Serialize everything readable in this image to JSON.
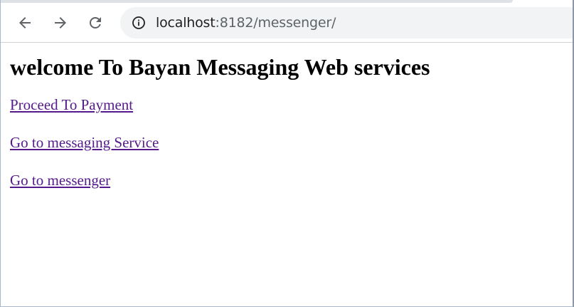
{
  "browser": {
    "url_host": "localhost",
    "url_rest": ":8182/messenger/",
    "icons": {
      "back": "back-arrow-icon",
      "forward": "forward-arrow-icon",
      "reload": "reload-icon",
      "info": "info-icon"
    }
  },
  "page": {
    "heading": "welcome To Bayan Messaging Web services",
    "links": [
      {
        "label": "Proceed To Payment"
      },
      {
        "label": "Go to messaging Service"
      },
      {
        "label": "Go to messenger"
      }
    ]
  },
  "colors": {
    "visited_link": "#551a8b",
    "omnibox_bg": "#f1f3f4",
    "icon": "#5f6368"
  }
}
